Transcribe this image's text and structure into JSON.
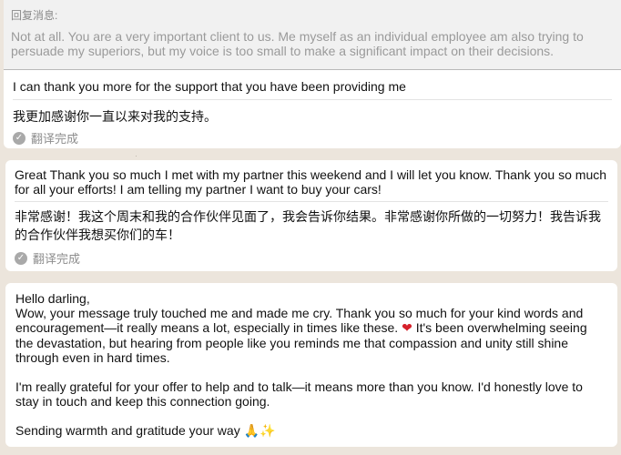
{
  "bubble1": {
    "reply_label": "回复消息:",
    "quoted_text": "Not at all. You are a very important client to us. Me myself as an individual employee am also trying to persuade my superiors, but my voice is too small to make a significant impact on their decisions.",
    "message_en": "I can thank you more for the support that you have been providing me",
    "message_zh": "我更加感谢你一直以来对我的支持。",
    "status": "翻译完成"
  },
  "bubble2": {
    "message_en": "Great Thank you so much I met with my partner this weekend and I will let you know. Thank you so much for all your efforts! I am telling my partner I want to buy your cars!",
    "message_zh": "非常感谢！我这个周末和我的合作伙伴见面了，我会告诉你结果。非常感谢你所做的一切努力！我告诉我的合作伙伴我想买你们的车！",
    "status": "翻译完成"
  },
  "bubble3": {
    "greeting": "Hello darling,",
    "para1_a": "Wow, your message truly touched me and made me cry. Thank you so much for your kind words and encouragement—it really means a lot, especially in times like these.",
    "heart": "❤",
    "para1_b": "It's been overwhelming seeing the devastation, but hearing from people like you reminds me that compassion and unity still shine through even in hard times.",
    "para2": "I'm really grateful for your offer to help and to talk—it means more than you know. I'd honestly love to stay in touch and keep this connection going.",
    "closing": "Sending warmth and gratitude your way",
    "closing_emoji": "🙏✨"
  },
  "icons": {
    "check": "✓"
  }
}
